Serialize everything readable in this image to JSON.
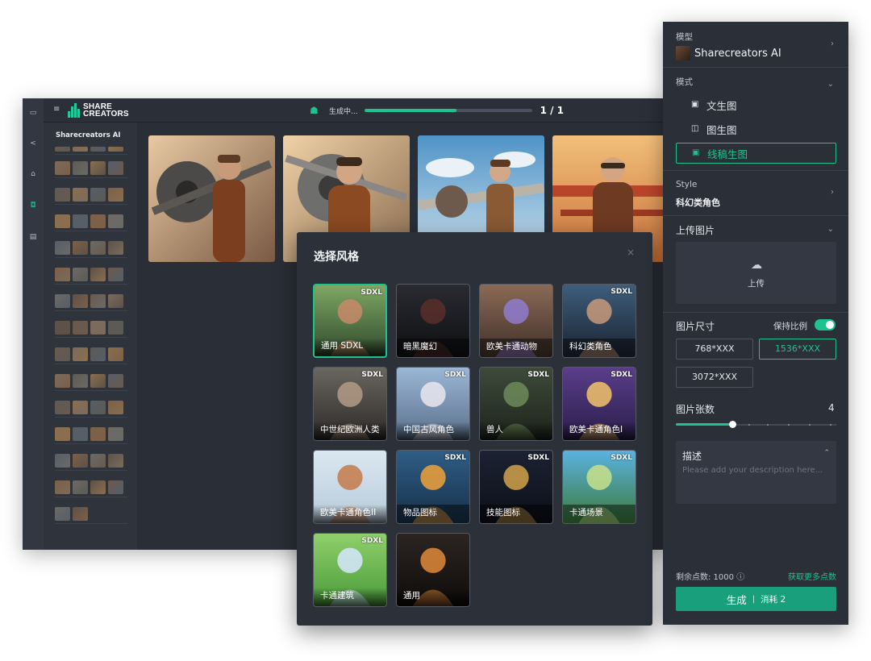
{
  "app": {
    "logo_text_1": "SHARE",
    "logo_text_2": "CREATORS",
    "status_label": "生成中...",
    "progress": 0.55,
    "progress_count": "1 / 1",
    "left_panel_title": "Sharecreators AI",
    "rail_icons": [
      "folder-icon",
      "share-icon",
      "home-icon",
      "robot-icon",
      "database-icon"
    ]
  },
  "dialog": {
    "title": "选择风格",
    "close_icon": "close-icon",
    "styles": [
      {
        "label": "通用 SDXL",
        "badge": "SDXL",
        "selected": true
      },
      {
        "label": "暗黑魔幻",
        "badge": "",
        "selected": false
      },
      {
        "label": "欧美卡通动物",
        "badge": "",
        "selected": false
      },
      {
        "label": "科幻类角色",
        "badge": "SDXL",
        "selected": false
      },
      {
        "label": "中世纪欧洲人类",
        "badge": "SDXL",
        "selected": false
      },
      {
        "label": "中国古风角色",
        "badge": "SDXL",
        "selected": false
      },
      {
        "label": "兽人",
        "badge": "SDXL",
        "selected": false
      },
      {
        "label": "欧美卡通角色I",
        "badge": "SDXL",
        "selected": false
      },
      {
        "label": "欧美卡通角色II",
        "badge": "",
        "selected": false
      },
      {
        "label": "物品图标",
        "badge": "SDXL",
        "selected": false
      },
      {
        "label": "技能图标",
        "badge": "SDXL",
        "selected": false
      },
      {
        "label": "卡通场景",
        "badge": "SDXL",
        "selected": false
      },
      {
        "label": "卡通建筑",
        "badge": "SDXL",
        "selected": false
      },
      {
        "label": "通用",
        "badge": "",
        "selected": false
      }
    ]
  },
  "settings": {
    "model_label": "模型",
    "model_name": "Sharecreators AI",
    "mode_label": "模式",
    "modes": [
      "文生图",
      "图生图",
      "线稿生图"
    ],
    "active_mode": 2,
    "style_label": "Style",
    "style_value": "科幻类角色",
    "upload_label": "上传图片",
    "upload_button": "上传",
    "size_label": "图片尺寸",
    "keep_ratio_label": "保持比例",
    "keep_ratio": true,
    "sizes": [
      "768*XXX",
      "1536*XXX",
      "3072*XXX"
    ],
    "active_size": 1,
    "count_label": "图片张数",
    "count_value": "4",
    "count_fraction": 0.35,
    "desc_label": "描述",
    "desc_placeholder": "Please add your description here...",
    "points_label": "剩余点数: 1000",
    "points_more": "获取更多点数",
    "generate_label": "生成",
    "generate_sep": "|",
    "generate_cost": "消耗 2"
  },
  "colors": {
    "accent": "#1fc28f",
    "button": "#1a9f7c",
    "panel": "#2b2f38"
  }
}
